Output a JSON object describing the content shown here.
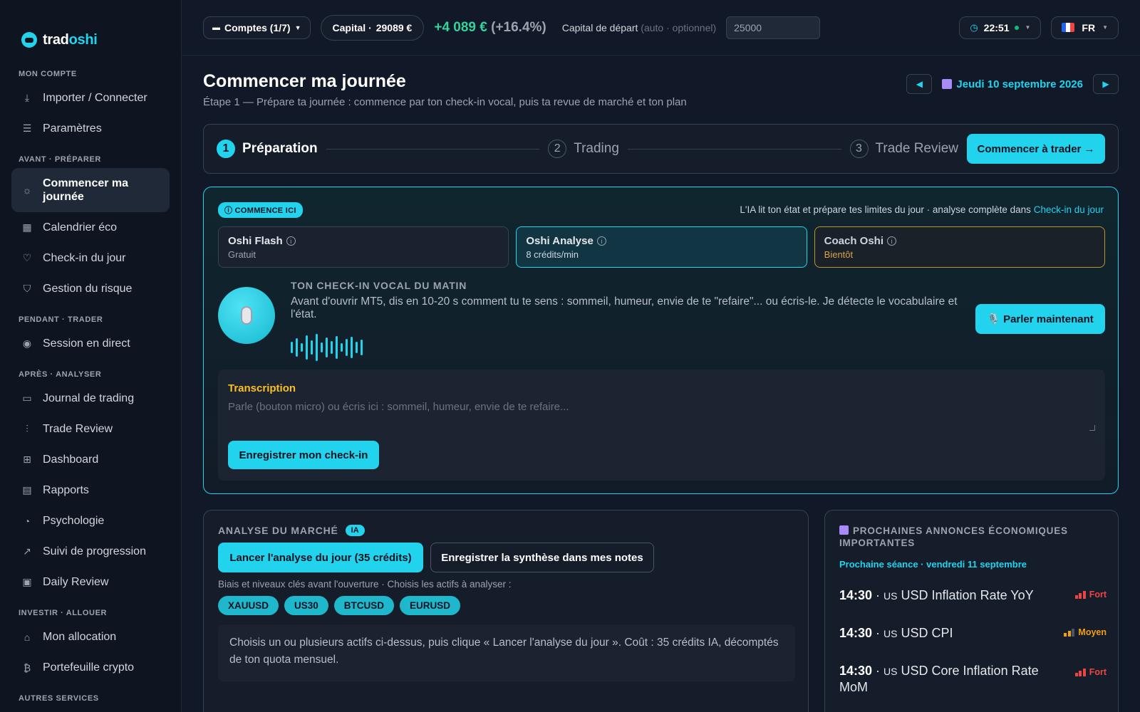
{
  "brand": {
    "name_part1": "trad",
    "name_part2": "oshi"
  },
  "sidebar": {
    "sections": {
      "account": "MON COMPTE",
      "before": "AVANT · PRÉPARER",
      "during": "PENDANT · TRADER",
      "after": "APRÈS · ANALYSER",
      "invest": "INVESTIR · ALLOUER",
      "other": "AUTRES SERVICES"
    },
    "items": {
      "import": "Importer / Connecter",
      "settings": "Paramètres",
      "start_day": "Commencer ma journée",
      "calendar": "Calendrier éco",
      "checkin": "Check-in du jour",
      "risk": "Gestion du risque",
      "live": "Session en direct",
      "journal": "Journal de trading",
      "trade_review": "Trade Review",
      "dashboard": "Dashboard",
      "reports": "Rapports",
      "psychology": "Psychologie",
      "progress": "Suivi de progression",
      "daily_review": "Daily Review",
      "allocation": "Mon allocation",
      "crypto": "Portefeuille crypto"
    }
  },
  "topbar": {
    "accounts": "Comptes (1/7)",
    "capital_label": "Capital · ",
    "capital_value": "29089 €",
    "gain": "+4 089 €",
    "gain_pct": "(+16.4%)",
    "start_capital_label": "Capital de départ",
    "start_capital_hint": "(auto · optionnel)",
    "start_capital_value": "25000",
    "time": "22:51",
    "lang": "FR"
  },
  "page": {
    "title": "Commencer ma journée",
    "subtitle": "Étape 1 — Prépare ta journée : commence par ton check-in vocal, puis ta revue de marché et ton plan",
    "date": "Jeudi 10 septembre 2026"
  },
  "stepper": {
    "steps": [
      {
        "num": "1",
        "label": "Préparation"
      },
      {
        "num": "2",
        "label": "Trading"
      },
      {
        "num": "3",
        "label": "Trade Review"
      }
    ],
    "cta": "Commencer à trader →"
  },
  "checkin": {
    "badge": "ⓘ COMMENCE ICI",
    "note": "L'IA lit ton état et prépare tes limites du jour · analyse complète dans ",
    "note_link": "Check-in du jour",
    "modes": [
      {
        "title": "Oshi Flash",
        "sub": "Gratuit"
      },
      {
        "title": "Oshi Analyse",
        "sub": "8 crédits/min"
      },
      {
        "title": "Coach Oshi",
        "sub": "Bientôt"
      }
    ],
    "voice_title": "TON CHECK-IN VOCAL DU MATIN",
    "voice_text": "Avant d'ouvrir MT5, dis en 10-20 s comment tu te sens : sommeil, humeur, envie de te \"refaire\"... ou écris-le. Je détecte le vocabulaire et l'état.",
    "speak_button": "🎙️ Parler maintenant",
    "transcript_label": "Transcription",
    "transcript_placeholder": "Parle (bouton micro) ou écris ici : sommeil, humeur, envie de te refaire...",
    "save_button": "Enregistrer mon check-in"
  },
  "market": {
    "title": "ANALYSE DU MARCHÉ",
    "badge": "IA",
    "launch_button": "Lancer l'analyse du jour (35 crédits)",
    "save_button": "Enregistrer la synthèse dans mes notes",
    "subtitle": "Biais et niveaux clés avant l'ouverture · Choisis les actifs à analyser :",
    "assets": [
      "XAUUSD",
      "US30",
      "BTCUSD",
      "EURUSD"
    ],
    "info": "Choisis un ou plusieurs actifs ci-dessus, puis clique « Lancer l'analyse du jour ». Coût : 35 crédits IA, décomptés de ton quota mensuel."
  },
  "eco": {
    "title": "PROCHAINES ANNONCES ÉCONOMIQUES IMPORTANTES",
    "next_session": "Prochaine séance · vendredi 11 septembre",
    "events": [
      {
        "time": "14:30",
        "country": "US",
        "name": "USD Inflation Rate YoY",
        "impact": "Fort"
      },
      {
        "time": "14:30",
        "country": "US",
        "name": "USD CPI",
        "impact": "Moyen"
      },
      {
        "time": "14:30",
        "country": "US",
        "name": "USD Core Inflation Rate MoM",
        "impact": "Fort"
      }
    ]
  },
  "colors": {
    "accent": "#22d3ee",
    "positive": "#34d399",
    "warning": "#fbbf24",
    "high": "#ef4444",
    "medium": "#f59e0b"
  }
}
